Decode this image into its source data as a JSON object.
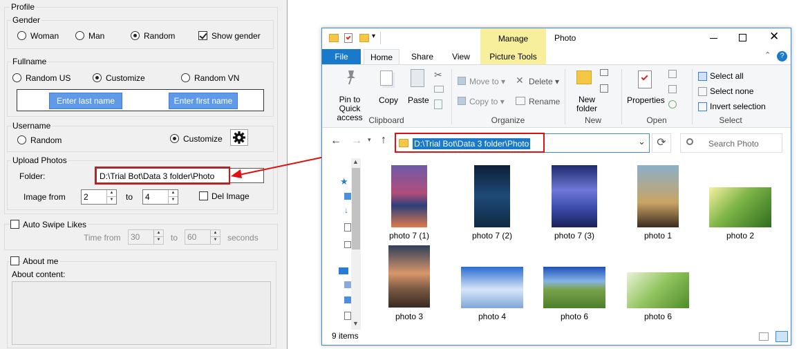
{
  "profile": {
    "title": "Profile",
    "gender": {
      "title": "Gender",
      "options": [
        "Woman",
        "Man",
        "Random"
      ],
      "selected": "Random",
      "show_gender_label": "Show gender",
      "show_gender_checked": true
    },
    "fullname": {
      "title": "Fullname",
      "options": [
        "Random US",
        "Customize",
        "Random VN"
      ],
      "selected": "Customize",
      "last_name_btn": "Enter last name",
      "first_name_btn": "Enter first name"
    },
    "username": {
      "title": "Username",
      "options": [
        "Random",
        "Customize"
      ],
      "selected": "Customize"
    },
    "upload": {
      "title": "Upload Photos",
      "folder_label": "Folder:",
      "folder_value": "D:\\Trial Bot\\Data 3 folder\\Photo",
      "image_from_label": "Image from",
      "from_value": "2",
      "to_label": "to",
      "to_value": "4",
      "del_image_label": "Del Image"
    },
    "auto_swipe": {
      "label": "Auto Swipe  Likes",
      "time_from_label": "Time from",
      "from_value": "30",
      "to_label": "to",
      "to_value": "60",
      "seconds_label": "seconds"
    },
    "about": {
      "checkbox_label": "About me",
      "content_label": "About content:"
    }
  },
  "explorer": {
    "title": "Photo",
    "manage_label": "Manage",
    "tabs": {
      "file": "File",
      "home": "Home",
      "share": "Share",
      "view": "View",
      "picture_tools": "Picture Tools"
    },
    "ribbon": {
      "pin_label": "Pin to Quick access",
      "copy": "Copy",
      "paste": "Paste",
      "move_to": "Move to",
      "copy_to": "Copy to",
      "delete": "Delete",
      "rename": "Rename",
      "new_folder": "New folder",
      "properties": "Properties",
      "select_all": "Select all",
      "select_none": "Select none",
      "invert_selection": "Invert selection",
      "groups": {
        "clipboard": "Clipboard",
        "organize": "Organize",
        "new": "New",
        "open": "Open",
        "select": "Select"
      }
    },
    "address": "D:\\Trial Bot\\Data 3 folder\\Photo",
    "search_placeholder": "Search Photo",
    "files": [
      "photo  7 (1)",
      "photo  7 (2)",
      "photo  7 (3)",
      "photo 1",
      "photo 2",
      "photo 3",
      "photo 4",
      "photo 6",
      "photo 6"
    ],
    "status": "9 items"
  },
  "colors": {
    "annotation": "#e01010",
    "file_tab": "#1979ca",
    "manage_tab": "#f8ef9c",
    "button_blue": "#5e9ae8"
  },
  "icons": [
    "settings-gear-icon",
    "folder-icon",
    "pin-icon",
    "copy-icon",
    "paste-icon",
    "scissors-icon",
    "move-to-icon",
    "copy-to-icon",
    "delete-icon",
    "rename-icon",
    "new-folder-icon",
    "properties-icon",
    "select-all-icon",
    "back-arrow-icon",
    "forward-arrow-icon",
    "up-arrow-icon",
    "refresh-icon",
    "search-icon"
  ]
}
